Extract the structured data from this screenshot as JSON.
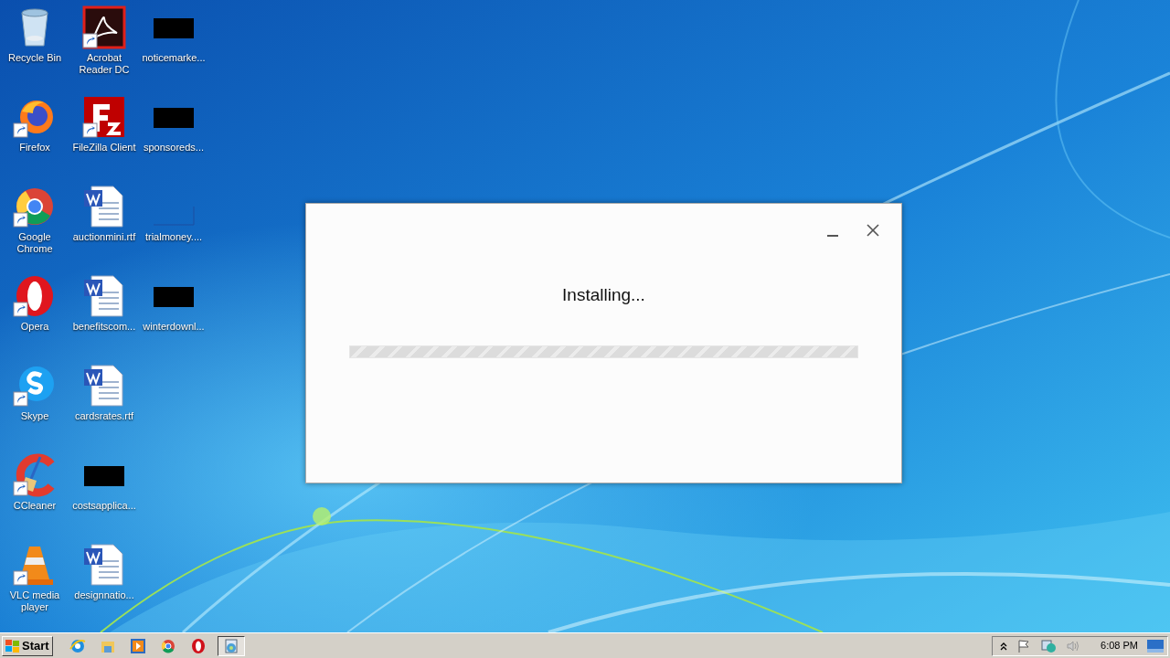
{
  "desktop": {
    "icons": [
      {
        "label": "Recycle Bin",
        "kind": "recycle",
        "shortcut": false
      },
      {
        "label": "Firefox",
        "kind": "firefox",
        "shortcut": true
      },
      {
        "label": "Google Chrome",
        "kind": "chrome",
        "shortcut": true
      },
      {
        "label": "Opera",
        "kind": "opera",
        "shortcut": true
      },
      {
        "label": "Skype",
        "kind": "skype",
        "shortcut": true
      },
      {
        "label": "CCleaner",
        "kind": "ccleaner",
        "shortcut": true
      },
      {
        "label": "VLC media player",
        "kind": "vlc",
        "shortcut": true
      },
      {
        "label": "Acrobat Reader DC",
        "kind": "acrobat",
        "shortcut": true
      },
      {
        "label": "FileZilla Client",
        "kind": "filezilla",
        "shortcut": true
      },
      {
        "label": "auctionmini.rtf",
        "kind": "word",
        "shortcut": false
      },
      {
        "label": "benefitscom...",
        "kind": "word",
        "shortcut": false
      },
      {
        "label": "cardsrates.rtf",
        "kind": "word",
        "shortcut": false
      },
      {
        "label": "costsapplica...",
        "kind": "blank",
        "shortcut": false
      },
      {
        "label": "designnatio...",
        "kind": "word",
        "shortcut": false
      },
      {
        "label": "noticemarke...",
        "kind": "blank",
        "shortcut": false
      },
      {
        "label": "sponsoreds...",
        "kind": "blank",
        "shortcut": false
      },
      {
        "label": "trialmoney....",
        "kind": "empty",
        "shortcut": false
      },
      {
        "label": "winterdownl...",
        "kind": "blank",
        "shortcut": false
      }
    ]
  },
  "dialog": {
    "message": "Installing...",
    "progress": {
      "indeterminate": true
    }
  },
  "taskbar": {
    "start": "Start",
    "quick_launch": [
      {
        "kind": "ie"
      },
      {
        "kind": "explorer"
      },
      {
        "kind": "mediaplayer"
      },
      {
        "kind": "chrome"
      },
      {
        "kind": "opera"
      }
    ],
    "tasks": [
      {
        "kind": "setup"
      }
    ],
    "tray": [
      {
        "kind": "arrow"
      },
      {
        "kind": "flag"
      },
      {
        "kind": "network"
      },
      {
        "kind": "volume"
      }
    ],
    "clock": "6:08 PM"
  }
}
